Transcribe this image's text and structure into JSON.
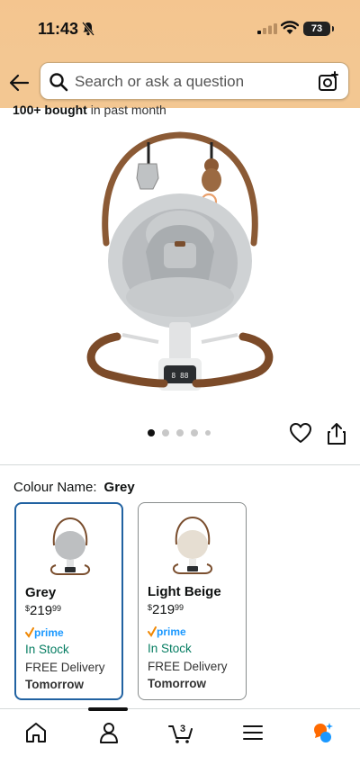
{
  "status": {
    "time": "11:43",
    "battery": "73"
  },
  "search": {
    "placeholder": "Search or ask a question"
  },
  "product": {
    "bought_bold": "100+ bought",
    "bought_rest": " in past month",
    "image_count": 5,
    "active_image": 1
  },
  "colour": {
    "label": "Colour Name:",
    "selected": "Grey",
    "options": [
      {
        "name": "Grey",
        "price_symbol": "$",
        "price_whole": "219",
        "price_fraction": "99",
        "prime": "prime",
        "stock": "In Stock",
        "delivery": "FREE Delivery",
        "when": "Tomorrow",
        "selected": true
      },
      {
        "name": "Light Beige",
        "price_symbol": "$",
        "price_whole": "219",
        "price_fraction": "99",
        "prime": "prime",
        "stock": "In Stock",
        "delivery": "FREE Delivery",
        "when": "Tomorrow",
        "selected": false
      }
    ]
  },
  "tabbar": {
    "cart_count": "3",
    "active_tab": "me"
  },
  "colors": {
    "header": "#f3c792",
    "selected_border": "#2162a1",
    "stock_green": "#067d62",
    "prime_blue": "#1a98ff"
  }
}
